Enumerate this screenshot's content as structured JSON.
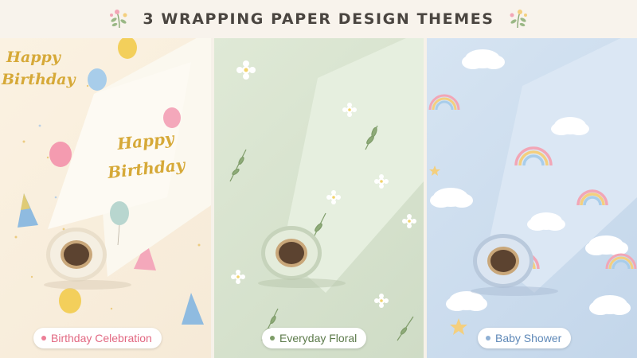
{
  "header": {
    "title": "3 WRAPPING PAPER DESIGN THEMES"
  },
  "themes": [
    {
      "label": "Birthday Celebration",
      "paper_text": "Happy Birthday",
      "accent": "#e26882"
    },
    {
      "label": "Everyday Floral",
      "accent": "#5c7a4a"
    },
    {
      "label": "Baby Shower",
      "accent": "#5f89b8"
    }
  ],
  "icons": {
    "header_left": "floral-sprig-icon",
    "header_right": "floral-sprig-icon",
    "label_dot": "dot-icon"
  }
}
